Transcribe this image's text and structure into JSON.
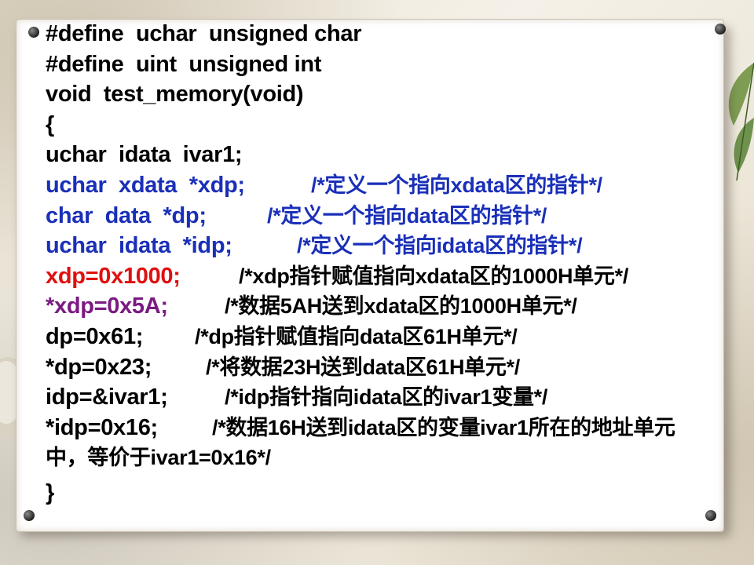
{
  "code": {
    "line1": "#define  uchar  unsigned char",
    "line2": "#define  uint  unsigned int",
    "line3": "void  test_memory(void)",
    "line4": "{",
    "line5": "uchar  idata  ivar1;",
    "line6": {
      "stmt": "uchar  xdata  *xdp;",
      "comment": "/*定义一个指向xdata区的指针*/"
    },
    "line7": {
      "stmt": "char  data  *dp;",
      "comment": "/*定义一个指向data区的指针*/"
    },
    "line8": {
      "stmt": "uchar  idata  *idp;",
      "comment": "/*定义一个指向idata区的指针*/"
    },
    "line9": {
      "stmt": "xdp=0x1000;",
      "comment": "/*xdp指针赋值指向xdata区的1000H单元*/"
    },
    "line10": {
      "stmt": "*xdp=0x5A;",
      "comment": "/*数据5AH送到xdata区的1000H单元*/"
    },
    "line11": {
      "stmt": "dp=0x61;",
      "comment": "/*dp指针赋值指向data区61H单元*/"
    },
    "line12": {
      "stmt": "*dp=0x23;",
      "comment": "/*将数据23H送到data区61H单元*/"
    },
    "line13": {
      "stmt": "idp=&ivar1;",
      "comment": "/*idp指针指向idata区的ivar1变量*/"
    },
    "line14": {
      "stmt": "*idp=0x16;",
      "comment": "/*数据16H送到idata区的变量ivar1所在的地址单元中，等价于ivar1=0x16*/"
    },
    "line15": "}"
  },
  "colors": {
    "blue": "#1a2fb8",
    "red": "#e01010",
    "purple": "#7a1a82",
    "black": "#000000"
  }
}
